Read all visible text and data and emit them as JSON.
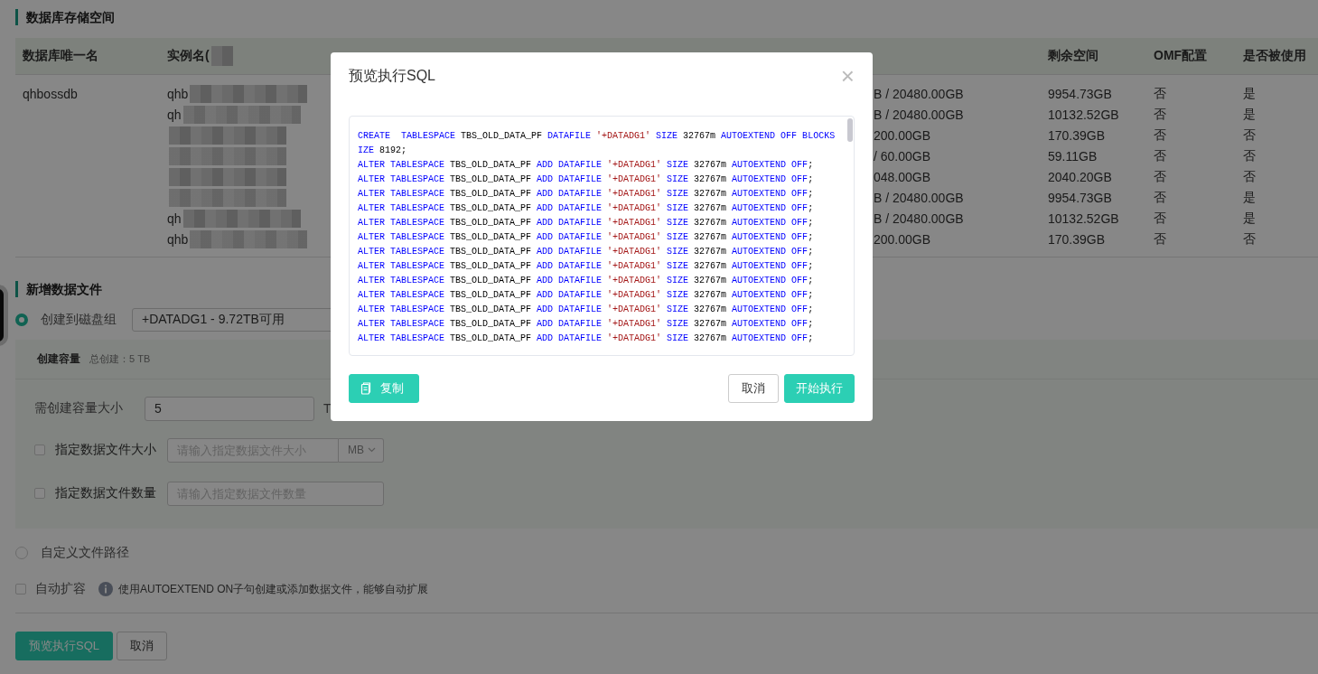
{
  "storage_section": {
    "title": "数据库存储空间",
    "header": {
      "db": "数据库唯一名",
      "instance": "实例名(",
      "free": "剩余空间",
      "omf": "OMF配置",
      "used": "是否被使用"
    },
    "rows": [
      {
        "db": "qhbossdb",
        "instance": "qhb",
        "capacity": "B / 20480.00GB",
        "free": "9954.73GB",
        "omf": "否",
        "used": "是"
      },
      {
        "instance": "qh",
        "capacity": "B / 20480.00GB",
        "free": "10132.52GB",
        "omf": "否",
        "used": "是"
      },
      {
        "capacity": "200.00GB",
        "free": "170.39GB",
        "omf": "否",
        "used": "否"
      },
      {
        "capacity": "/ 60.00GB",
        "free": "59.11GB",
        "omf": "否",
        "used": "否"
      },
      {
        "capacity": "048.00GB",
        "free": "2040.20GB",
        "omf": "否",
        "used": "否"
      },
      {
        "capacity": "B / 20480.00GB",
        "free": "9954.73GB",
        "omf": "否",
        "used": "是"
      },
      {
        "instance": "qh",
        "capacity": "B / 20480.00GB",
        "free": "10132.52GB",
        "omf": "否",
        "used": "是"
      },
      {
        "instance": "qhb",
        "capacity": "200.00GB",
        "free": "170.39GB",
        "omf": "否",
        "used": "否"
      }
    ]
  },
  "new_datafile_section": {
    "title": "新增数据文件",
    "diskgroup_option": {
      "label": "创建到磁盘组",
      "selected": true,
      "value": "+DATADG1 - 9.72TB可用"
    },
    "capacity_panel": {
      "title": "创建容量",
      "total": "总创建：5 TB",
      "size_label": "需创建容量大小",
      "size_value": "5",
      "size_unit": "T",
      "file_size": {
        "label": "指定数据文件大小",
        "checked": false,
        "placeholder": "请输入指定数据文件大小",
        "unit": "MB"
      },
      "file_count": {
        "label": "指定数据文件数量",
        "checked": false,
        "placeholder": "请输入指定数据文件数量"
      }
    },
    "custom_path_option": {
      "label": "自定义文件路径",
      "selected": false
    },
    "autoextend": {
      "label": "自动扩容",
      "checked": false,
      "hint": "使用AUTOEXTEND ON子句创建或添加数据文件，能够自动扩展"
    },
    "buttons": [
      {
        "label": "预览执行SQL",
        "kind": "primary"
      },
      {
        "label": "取消",
        "kind": "default"
      }
    ]
  },
  "dialog": {
    "title": "预览执行SQL",
    "close": "×",
    "sql_lines": [
      [
        {
          "kind": "kw",
          "t": "CREATE  TABLESPACE "
        },
        {
          "kind": "name",
          "t": "TBS_OLD_DATA_PF "
        },
        {
          "kind": "kw",
          "t": "DATAFILE "
        },
        {
          "kind": "str",
          "t": "'+DATADG1' "
        },
        {
          "kind": "kw",
          "t": "SIZE "
        },
        {
          "kind": "num",
          "t": "32767m "
        },
        {
          "kind": "kw",
          "t": "AUTOEXTEND OFF BLOCKSIZE "
        },
        {
          "kind": "num",
          "t": "8192"
        },
        {
          "kind": "punct",
          "t": ";"
        }
      ],
      [
        {
          "kind": "kw",
          "t": "ALTER TABLESPACE "
        },
        {
          "kind": "name",
          "t": "TBS_OLD_DATA_PF "
        },
        {
          "kind": "kw",
          "t": "ADD DATAFILE "
        },
        {
          "kind": "str",
          "t": "'+DATADG1' "
        },
        {
          "kind": "kw",
          "t": "SIZE "
        },
        {
          "kind": "num",
          "t": "32767m "
        },
        {
          "kind": "kw",
          "t": "AUTOEXTEND OFF"
        },
        {
          "kind": "punct",
          "t": ";"
        }
      ],
      [
        {
          "kind": "kw",
          "t": "ALTER TABLESPACE "
        },
        {
          "kind": "name",
          "t": "TBS_OLD_DATA_PF "
        },
        {
          "kind": "kw",
          "t": "ADD DATAFILE "
        },
        {
          "kind": "str",
          "t": "'+DATADG1' "
        },
        {
          "kind": "kw",
          "t": "SIZE "
        },
        {
          "kind": "num",
          "t": "32767m "
        },
        {
          "kind": "kw",
          "t": "AUTOEXTEND OFF"
        },
        {
          "kind": "punct",
          "t": ";"
        }
      ],
      [
        {
          "kind": "kw",
          "t": "ALTER TABLESPACE "
        },
        {
          "kind": "name",
          "t": "TBS_OLD_DATA_PF "
        },
        {
          "kind": "kw",
          "t": "ADD DATAFILE "
        },
        {
          "kind": "str",
          "t": "'+DATADG1' "
        },
        {
          "kind": "kw",
          "t": "SIZE "
        },
        {
          "kind": "num",
          "t": "32767m "
        },
        {
          "kind": "kw",
          "t": "AUTOEXTEND OFF"
        },
        {
          "kind": "punct",
          "t": ";"
        }
      ],
      [
        {
          "kind": "kw",
          "t": "ALTER TABLESPACE "
        },
        {
          "kind": "name",
          "t": "TBS_OLD_DATA_PF "
        },
        {
          "kind": "kw",
          "t": "ADD DATAFILE "
        },
        {
          "kind": "str",
          "t": "'+DATADG1' "
        },
        {
          "kind": "kw",
          "t": "SIZE "
        },
        {
          "kind": "num",
          "t": "32767m "
        },
        {
          "kind": "kw",
          "t": "AUTOEXTEND OFF"
        },
        {
          "kind": "punct",
          "t": ";"
        }
      ],
      [
        {
          "kind": "kw",
          "t": "ALTER TABLESPACE "
        },
        {
          "kind": "name",
          "t": "TBS_OLD_DATA_PF "
        },
        {
          "kind": "kw",
          "t": "ADD DATAFILE "
        },
        {
          "kind": "str",
          "t": "'+DATADG1' "
        },
        {
          "kind": "kw",
          "t": "SIZE "
        },
        {
          "kind": "num",
          "t": "32767m "
        },
        {
          "kind": "kw",
          "t": "AUTOEXTEND OFF"
        },
        {
          "kind": "punct",
          "t": ";"
        }
      ],
      [
        {
          "kind": "kw",
          "t": "ALTER TABLESPACE "
        },
        {
          "kind": "name",
          "t": "TBS_OLD_DATA_PF "
        },
        {
          "kind": "kw",
          "t": "ADD DATAFILE "
        },
        {
          "kind": "str",
          "t": "'+DATADG1' "
        },
        {
          "kind": "kw",
          "t": "SIZE "
        },
        {
          "kind": "num",
          "t": "32767m "
        },
        {
          "kind": "kw",
          "t": "AUTOEXTEND OFF"
        },
        {
          "kind": "punct",
          "t": ";"
        }
      ],
      [
        {
          "kind": "kw",
          "t": "ALTER TABLESPACE "
        },
        {
          "kind": "name",
          "t": "TBS_OLD_DATA_PF "
        },
        {
          "kind": "kw",
          "t": "ADD DATAFILE "
        },
        {
          "kind": "str",
          "t": "'+DATADG1' "
        },
        {
          "kind": "kw",
          "t": "SIZE "
        },
        {
          "kind": "num",
          "t": "32767m "
        },
        {
          "kind": "kw",
          "t": "AUTOEXTEND OFF"
        },
        {
          "kind": "punct",
          "t": ";"
        }
      ],
      [
        {
          "kind": "kw",
          "t": "ALTER TABLESPACE "
        },
        {
          "kind": "name",
          "t": "TBS_OLD_DATA_PF "
        },
        {
          "kind": "kw",
          "t": "ADD DATAFILE "
        },
        {
          "kind": "str",
          "t": "'+DATADG1' "
        },
        {
          "kind": "kw",
          "t": "SIZE "
        },
        {
          "kind": "num",
          "t": "32767m "
        },
        {
          "kind": "kw",
          "t": "AUTOEXTEND OFF"
        },
        {
          "kind": "punct",
          "t": ";"
        }
      ],
      [
        {
          "kind": "kw",
          "t": "ALTER TABLESPACE "
        },
        {
          "kind": "name",
          "t": "TBS_OLD_DATA_PF "
        },
        {
          "kind": "kw",
          "t": "ADD DATAFILE "
        },
        {
          "kind": "str",
          "t": "'+DATADG1' "
        },
        {
          "kind": "kw",
          "t": "SIZE "
        },
        {
          "kind": "num",
          "t": "32767m "
        },
        {
          "kind": "kw",
          "t": "AUTOEXTEND OFF"
        },
        {
          "kind": "punct",
          "t": ";"
        }
      ],
      [
        {
          "kind": "kw",
          "t": "ALTER TABLESPACE "
        },
        {
          "kind": "name",
          "t": "TBS_OLD_DATA_PF "
        },
        {
          "kind": "kw",
          "t": "ADD DATAFILE "
        },
        {
          "kind": "str",
          "t": "'+DATADG1' "
        },
        {
          "kind": "kw",
          "t": "SIZE "
        },
        {
          "kind": "num",
          "t": "32767m "
        },
        {
          "kind": "kw",
          "t": "AUTOEXTEND OFF"
        },
        {
          "kind": "punct",
          "t": ";"
        }
      ],
      [
        {
          "kind": "kw",
          "t": "ALTER TABLESPACE "
        },
        {
          "kind": "name",
          "t": "TBS_OLD_DATA_PF "
        },
        {
          "kind": "kw",
          "t": "ADD DATAFILE "
        },
        {
          "kind": "str",
          "t": "'+DATADG1' "
        },
        {
          "kind": "kw",
          "t": "SIZE "
        },
        {
          "kind": "num",
          "t": "32767m "
        },
        {
          "kind": "kw",
          "t": "AUTOEXTEND OFF"
        },
        {
          "kind": "punct",
          "t": ";"
        }
      ],
      [
        {
          "kind": "kw",
          "t": "ALTER TABLESPACE "
        },
        {
          "kind": "name",
          "t": "TBS_OLD_DATA_PF "
        },
        {
          "kind": "kw",
          "t": "ADD DATAFILE "
        },
        {
          "kind": "str",
          "t": "'+DATADG1' "
        },
        {
          "kind": "kw",
          "t": "SIZE "
        },
        {
          "kind": "num",
          "t": "32767m "
        },
        {
          "kind": "kw",
          "t": "AUTOEXTEND OFF"
        },
        {
          "kind": "punct",
          "t": ";"
        }
      ],
      [
        {
          "kind": "kw",
          "t": "ALTER TABLESPACE "
        },
        {
          "kind": "name",
          "t": "TBS_OLD_DATA_PF "
        },
        {
          "kind": "kw",
          "t": "ADD DATAFILE "
        },
        {
          "kind": "str",
          "t": "'+DATADG1' "
        },
        {
          "kind": "kw",
          "t": "SIZE "
        },
        {
          "kind": "num",
          "t": "32767m "
        },
        {
          "kind": "kw",
          "t": "AUTOEXTEND OFF"
        },
        {
          "kind": "punct",
          "t": ";"
        }
      ]
    ],
    "buttons": [
      {
        "label": "复制",
        "kind": "copy"
      },
      {
        "label": "取消",
        "kind": "default"
      },
      {
        "label": "开始执行",
        "kind": "primary"
      }
    ]
  }
}
